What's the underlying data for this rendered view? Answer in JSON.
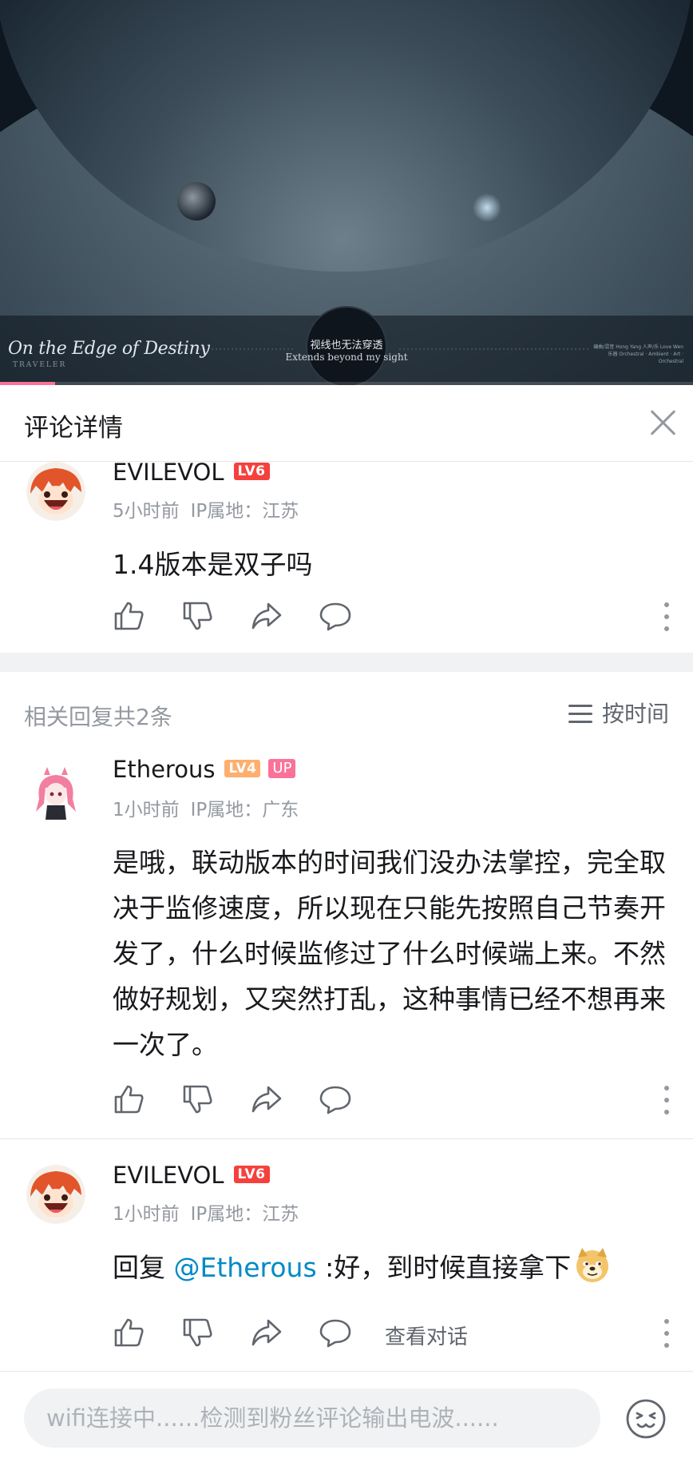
{
  "video": {
    "title": "On the Edge of Destiny",
    "subtitle": "TRAVELER",
    "caption_cn": "视线也无法穿透",
    "caption_en": "Extends beyond my sight",
    "credits": "编曲/混音 Hong Yang  人声/乐 Love Wen 乐器 Orchestral · Ambient · Art · Orchestral",
    "progress_fraction": 0.08,
    "accent": "#fb7299"
  },
  "header": {
    "title": "评论详情",
    "close_icon": "close-icon"
  },
  "root_comment": {
    "username": "EVILEVOL",
    "level": "LV6",
    "time": "5小时前",
    "ip": "IP属地：江苏",
    "content": "1.4版本是双子吗"
  },
  "replies_header": {
    "count_label": "相关回复共2条",
    "sort_label": "按时间"
  },
  "replies": [
    {
      "username": "Etherous",
      "level": "LV4",
      "up_badge": "UP",
      "time": "1小时前",
      "ip": "IP属地：广东",
      "content": "是哦，联动版本的时间我们没办法掌控，完全取决于监修速度，所以现在只能先按照自己节奏开发了，什么时候监修过了什么时候端上来。不然做好规划，又突然打乱，这种事情已经不想再来一次了。"
    },
    {
      "username": "EVILEVOL",
      "level": "LV6",
      "time": "1小时前",
      "ip": "IP属地：江苏",
      "content_prefix": "回复 ",
      "mention": "@Etherous",
      "content_text": " :好，到时候直接拿下",
      "emoji": "doge-emoji",
      "view_conversation": "查看对话"
    }
  ],
  "input": {
    "placeholder": "wifi连接中......检测到粉丝评论输出电波......"
  },
  "colors": {
    "level6": "#f5413d",
    "level4": "#feae6e",
    "up": "#fb7299",
    "mention": "#008ac5",
    "meta": "#9499a0"
  }
}
